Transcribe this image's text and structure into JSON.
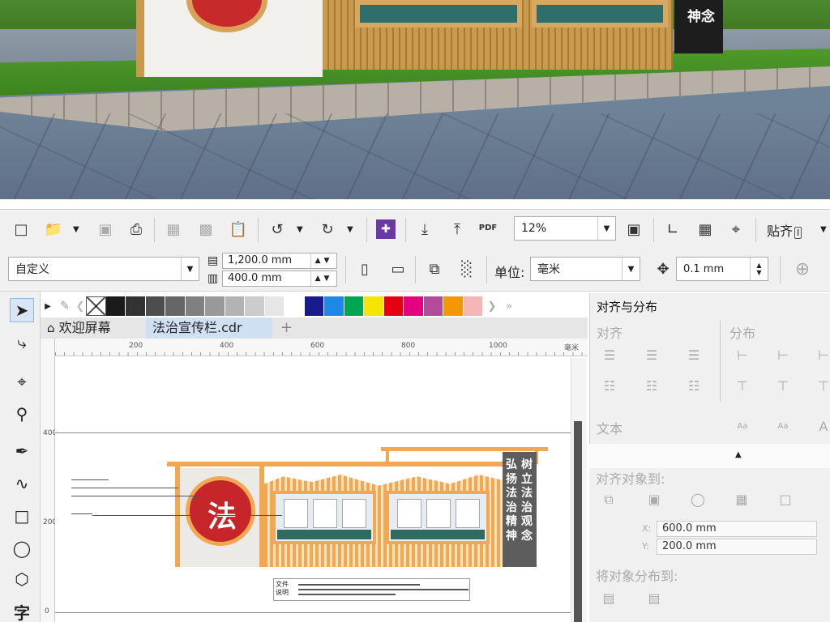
{
  "preview": {
    "board_text": "神念"
  },
  "toolbar1": {
    "icons": [
      "new-document-icon",
      "open-folder-icon",
      "save-icon",
      "print-icon",
      "import-disabled-icon",
      "export-disabled-icon",
      "paste-icon",
      "undo-icon",
      "redo-icon",
      "purple-transform-icon",
      "import-icon",
      "export-icon",
      "pdf-export-icon",
      "fullscreen-icon",
      "ruler-icon",
      "grid-icon",
      "guidelines-icon"
    ],
    "pdf_label": "PDF",
    "zoom_value": "12%",
    "snap_label": "贴齐",
    "snap_key": "I"
  },
  "toolbar2": {
    "page_preset": "自定义",
    "width_value": "1,200.0 mm",
    "height_value": "400.0 mm",
    "unit_label": "单位:",
    "unit_value": "毫米",
    "nudge_value": "0.1 mm"
  },
  "palette": {
    "colors": [
      "#1a1a1a",
      "#333333",
      "#4d4d4d",
      "#666666",
      "#808080",
      "#999999",
      "#b3b3b3",
      "#cccccc",
      "#e6e6e6",
      "#ffffff",
      "#1a1a8c",
      "#1e88e5",
      "#00a651",
      "#f5e600",
      "#e50012",
      "#e4007f",
      "#b24c9a",
      "#f39800",
      "#f4b6b6"
    ]
  },
  "tabs": {
    "welcome": "欢迎屏幕",
    "document": "法治宣传栏.cdr",
    "add": "+"
  },
  "rulers": {
    "h_labels": [
      "200",
      "400",
      "600",
      "800",
      "1000"
    ],
    "h_unit": "毫米",
    "v_labels": [
      "400",
      "200",
      "0"
    ]
  },
  "design": {
    "circle_text": "法",
    "side_col1": "树立法治观念",
    "side_col2": "弘扬法治精神",
    "doc_label": "文件说明"
  },
  "docker": {
    "title": "对齐与分布",
    "align": "对齐",
    "distribute": "分布",
    "text": "文本",
    "align_to": "对齐对象到:",
    "x_label": "X:",
    "x_value": "600.0 mm",
    "y_label": "Y:",
    "y_value": "200.0 mm",
    "distribute_to": "将对象分布到:"
  }
}
